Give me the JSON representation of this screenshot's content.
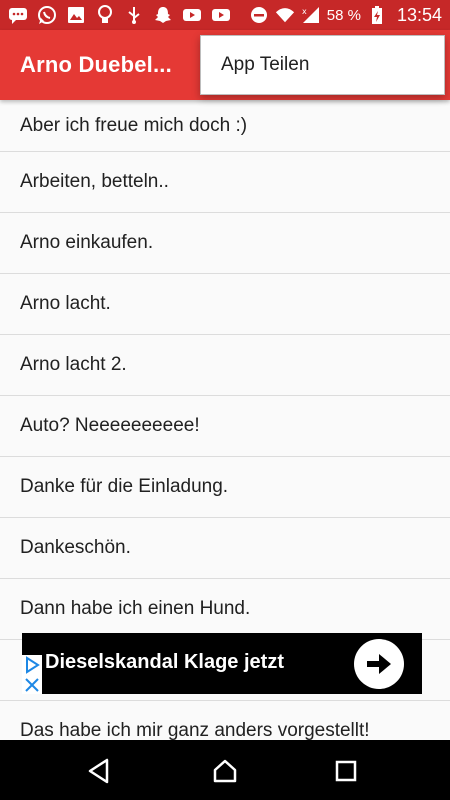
{
  "status_bar": {
    "battery_percent": "58 %",
    "time": "13:54",
    "icons": [
      "message-icon",
      "whatsapp-icon",
      "image-icon",
      "bulb-icon",
      "usb-icon",
      "snapchat-icon",
      "youtube-icon",
      "youtube-icon",
      "do-not-disturb-icon",
      "wifi-icon",
      "signal-icon",
      "battery-icon"
    ]
  },
  "app_bar": {
    "title": "Arno Duebel..."
  },
  "menu": {
    "share_label": "App Teilen"
  },
  "list": {
    "items": [
      "Aber ich freue mich doch :)",
      "Arbeiten, betteln..",
      "Arno einkaufen.",
      "Arno lacht.",
      "Arno lacht 2.",
      "Auto? Neeeeeeeeee!",
      "Danke für die Einladung.",
      "Dankeschön.",
      "Dann habe ich einen Hund.",
      "",
      "Das habe ich mir ganz anders vorgestellt!"
    ]
  },
  "ad": {
    "text": "Dieselskandal Klage jetzt",
    "colors": {
      "background": "#000000",
      "badge": "#1e88e5"
    }
  },
  "colors": {
    "status_bar": "#c62828",
    "app_bar": "#e53935"
  }
}
